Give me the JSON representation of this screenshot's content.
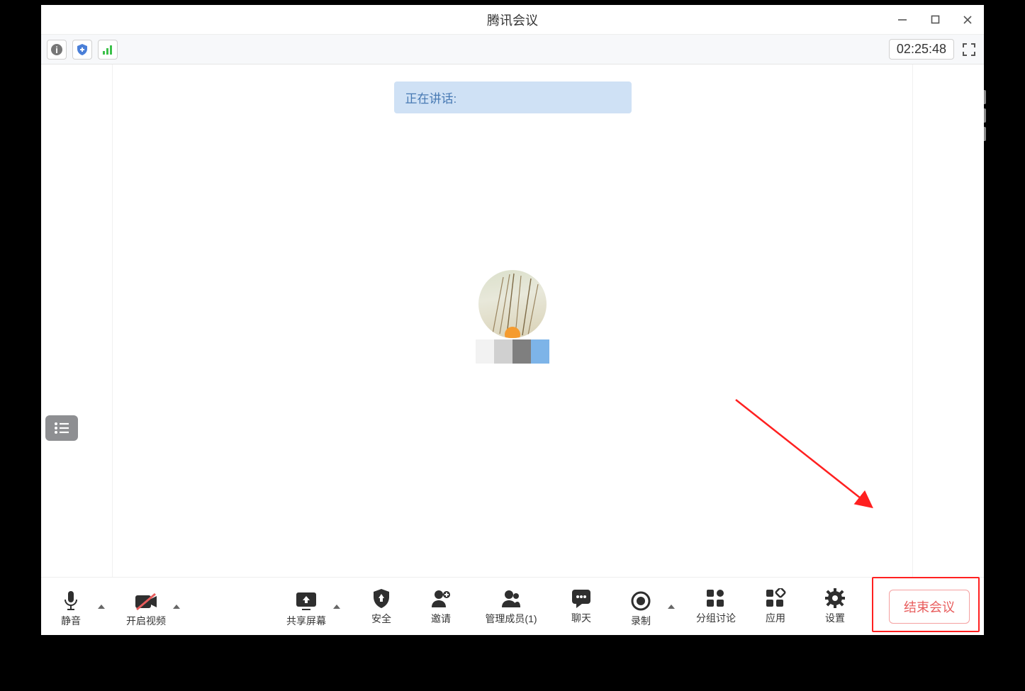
{
  "window": {
    "title": "腾讯会议"
  },
  "status": {
    "timer": "02:25:48"
  },
  "content": {
    "speaking_label": "正在讲话:"
  },
  "toolbar": {
    "mute": "静音",
    "video": "开启视频",
    "share": "共享屏幕",
    "security": "安全",
    "invite": "邀请",
    "members": "管理成员(1)",
    "chat": "聊天",
    "record": "录制",
    "breakout": "分组讨论",
    "apps": "应用",
    "settings": "设置",
    "end": "结束会议"
  }
}
